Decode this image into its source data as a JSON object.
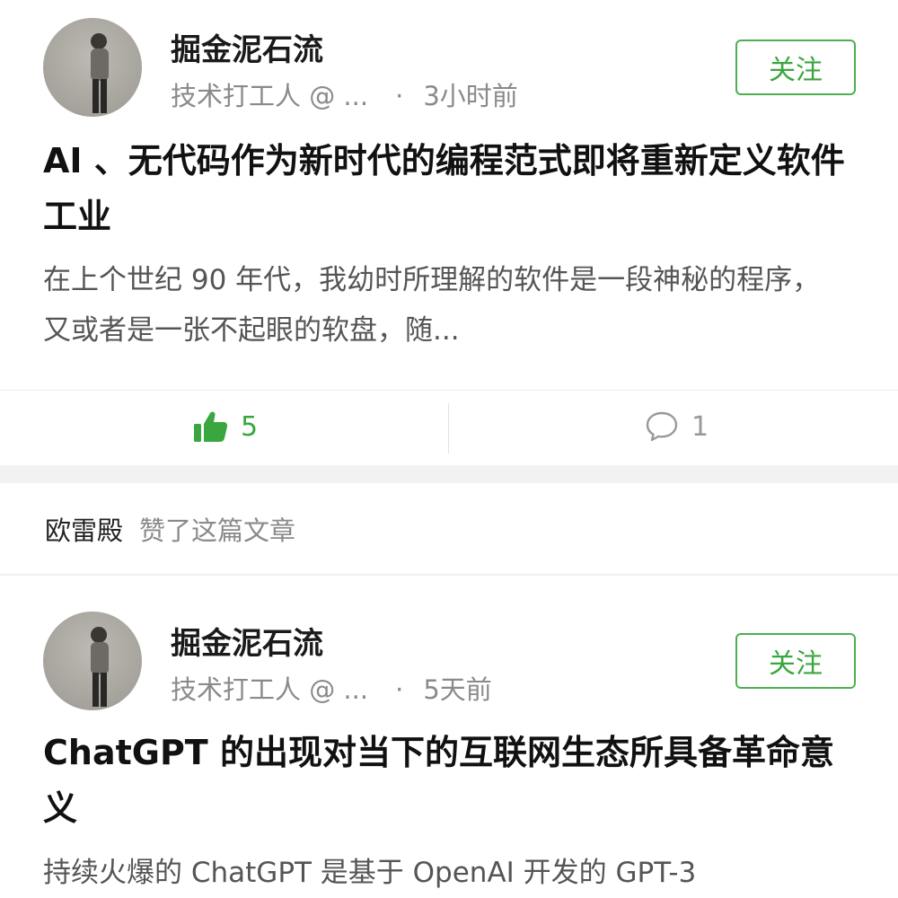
{
  "feed": [
    {
      "author": "掘金泥石流",
      "author_tag": "技术打工人 @ ...",
      "time": "3小时前",
      "follow_label": "关注",
      "title": "AI 、无代码作为新时代的编程范式即将重新定义软件工业",
      "excerpt": "在上个世纪 90 年代，我幼时所理解的软件是一段神秘的程序，又或者是一张不起眼的软盘，随...",
      "likes": "5",
      "comments": "1"
    },
    {
      "author": "掘金泥石流",
      "author_tag": "技术打工人 @ ...",
      "time": "5天前",
      "follow_label": "关注",
      "title": "ChatGPT 的出现对当下的互联网生态所具备革命意义",
      "excerpt": "持续火爆的 ChatGPT 是基于 OpenAI 开发的 GPT-3"
    }
  ],
  "activity": {
    "user": "欧雷殿",
    "action": "赞了这篇文章"
  },
  "colors": {
    "accent": "#3aa63f",
    "background": "#f2f2f2"
  },
  "icons": {
    "like": "thumbs-up-icon",
    "comment": "comment-bubble-icon"
  }
}
